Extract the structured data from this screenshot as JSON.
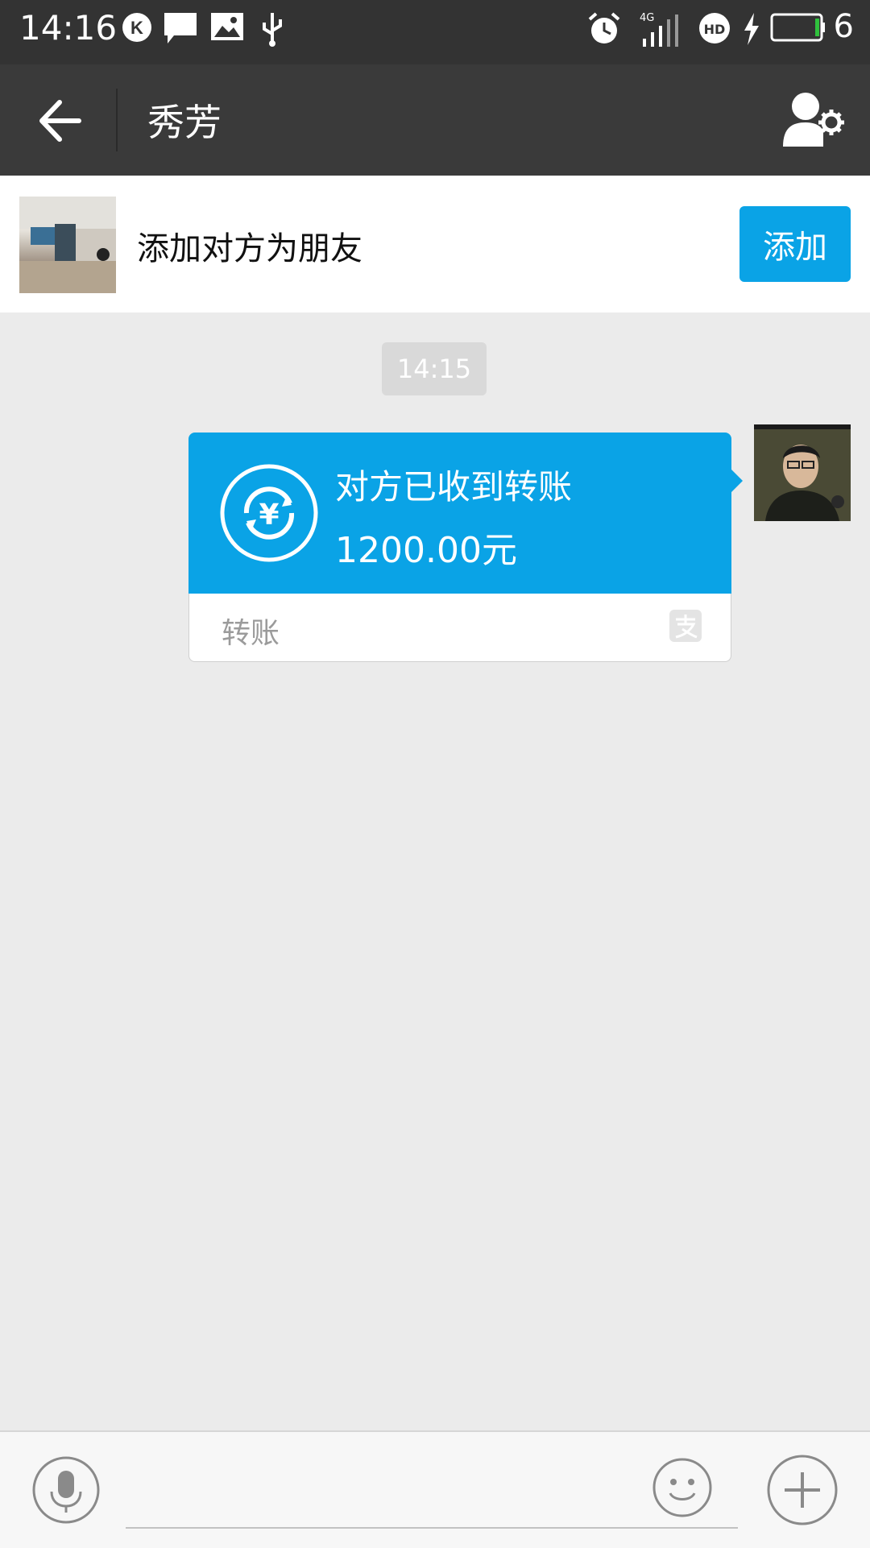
{
  "status_bar": {
    "time": "14:16",
    "network": "4G",
    "battery_text": "6"
  },
  "nav": {
    "title": "秀芳"
  },
  "add_friend": {
    "prompt": "添加对方为朋友",
    "button_label": "添加"
  },
  "chat": {
    "timestamp": "14:15",
    "transfer": {
      "status": "对方已收到转账",
      "amount": "1200.00元",
      "label": "转账"
    }
  },
  "icons": {
    "back": "arrow-left-icon",
    "profile_settings": "user-gear-icon",
    "voice": "microphone-icon",
    "emoji": "smiley-icon",
    "more": "plus-icon",
    "transfer": "yuan-refresh-icon",
    "alipay": "alipay-icon"
  },
  "colors": {
    "accent": "#0aa3e6",
    "navbar": "#3a3a3a",
    "statusbar": "#333333",
    "background": "#ebebeb"
  }
}
